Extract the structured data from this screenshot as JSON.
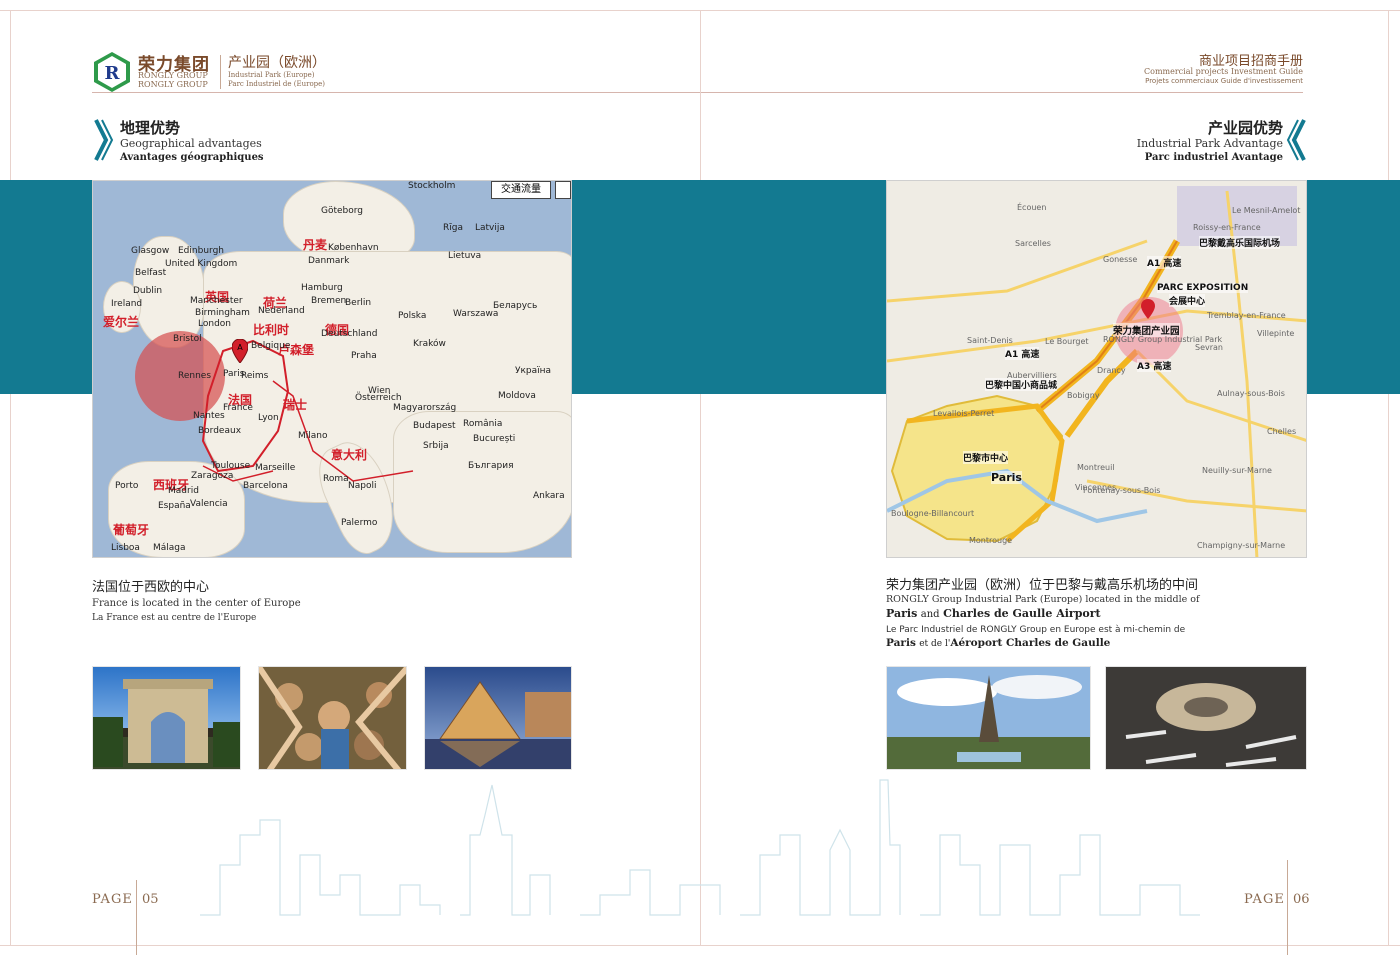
{
  "brand": {
    "name_zh": "荣力集团",
    "name_en1": "RONGLY GROUP",
    "name_en2": "RONGLY GROUP",
    "park_zh": "产业园（欧洲）",
    "park_en": "Industrial Park (Europe)",
    "park_fr": "Parc Industriel de (Europe)",
    "logo_letter": "R"
  },
  "right_header": {
    "title_zh": "商业项目招商手册",
    "title_en": "Commercial projects Investment Guide",
    "title_fr": "Projets commerciaux Guide d'investissement"
  },
  "left_section": {
    "title_zh": "地理优势",
    "title_en": "Geographical advantages",
    "title_fr": "Avantages géographiques",
    "map_button": "交通流量",
    "map_pin": "A",
    "caption_zh": "法国位于西欧的中心",
    "caption_en": "France is located in the center of Europe",
    "caption_fr": "La France est au centre de l'Europe",
    "map_labels_red": [
      "丹麦",
      "英国",
      "荷兰",
      "爱尔兰",
      "比利时",
      "德国",
      "卢森堡",
      "法国",
      "瑞士",
      "意大利",
      "西班牙",
      "葡萄牙"
    ],
    "map_labels_city": [
      "Stockholm",
      "Göteborg",
      "København",
      "Danmark",
      "Rīga",
      "Latvija",
      "Lietuva",
      "Glasgow",
      "Edinburgh",
      "United Kingdom",
      "Belfast",
      "Dublin",
      "Ireland",
      "Manchester",
      "Birmingham",
      "London",
      "Bristol",
      "Hamburg",
      "Bremen",
      "Berlin",
      "Nederland",
      "Deutschland",
      "Praha",
      "Warszawa",
      "Polska",
      "Kraków",
      "Belgique",
      "Paris",
      "Reims",
      "France",
      "Rennes",
      "Nantes",
      "Bordeaux",
      "Toulouse",
      "Marseille",
      "Lyon",
      "Milano",
      "Roma",
      "Napoli",
      "Madrid",
      "España",
      "Barcelona",
      "Valencia",
      "Zaragoza",
      "Lisboa",
      "Porto",
      "Málaga",
      "Wien",
      "Österreich",
      "Budapest",
      "Magyarország",
      "România",
      "București",
      "Srbija",
      "Беларусь",
      "Україна",
      "Moldova",
      "България",
      "Palermo",
      "Ankara"
    ]
  },
  "right_section": {
    "title_zh": "产业园优势",
    "title_en": "Industrial Park Advantage",
    "title_fr": "Parc industriel Avantage",
    "caption_zh": "荣力集团产业园（欧洲）位于巴黎与戴高乐机场的中间",
    "caption_en_line1": "RONGLY Group Industrial Park (Europe) located in the middle of",
    "caption_en_bold1": "Paris",
    "caption_en_and": "and",
    "caption_en_bold2": "Charles de Gaulle Airport",
    "caption_fr_line1": "Le Parc Industriel de RONGLY Group en Europe est à mi-chemin de",
    "caption_fr_bold1": "Paris",
    "caption_fr_mid": "et de l'",
    "caption_fr_bold2": "Aéroport Charles de Gaulle",
    "map_labels": {
      "airport": "巴黎戴高乐国际机场",
      "a1": "A1 高速",
      "expo": "PARC EXPOSITION",
      "expo_zh": "会展中心",
      "park": "荣力集团产业园",
      "park_en": "RONGLY Group Industrial Park",
      "a3": "A3 高速",
      "a1b": "A1 高速",
      "market": "巴黎中国小商品城",
      "center": "巴黎市中心",
      "paris": "Paris",
      "roissy": "Roissy-en-France",
      "sevran": "Sevran",
      "tremblay": "Tremblay-en-France",
      "bobigny": "Bobigny",
      "montreuil": "Montreuil",
      "saint_denis": "Saint-Denis",
      "aubervilliers": "Aubervilliers",
      "gonesse": "Gonesse",
      "sarcelles": "Sarcelles",
      "ecouen": "Écouen",
      "drancy": "Drancy",
      "villepinte": "Villepinte",
      "aulnay": "Aulnay-sous-Bois",
      "chelles": "Chelles",
      "boulogne": "Boulogne-Billancourt",
      "nanterre": "Levallois-Perret",
      "vincennes": "Vincennes",
      "neuilly": "Neuilly-sur-Marne",
      "fontenay": "Fontenay-sous-Bois",
      "champigny": "Champigny-sur-Marne",
      "montrouge": "Montrouge",
      "mesnil": "Le Mesnil-Amelot",
      "bourget": "Le Bourget"
    }
  },
  "footer": {
    "page_left_label": "PAGE",
    "page_left_num": "05",
    "page_right_label": "PAGE",
    "page_right_num": "06"
  },
  "colors": {
    "teal": "#137a91",
    "brand_brown": "#7a4a2b",
    "map_red": "#d21f2a",
    "page_border": "#d6b5ad"
  }
}
